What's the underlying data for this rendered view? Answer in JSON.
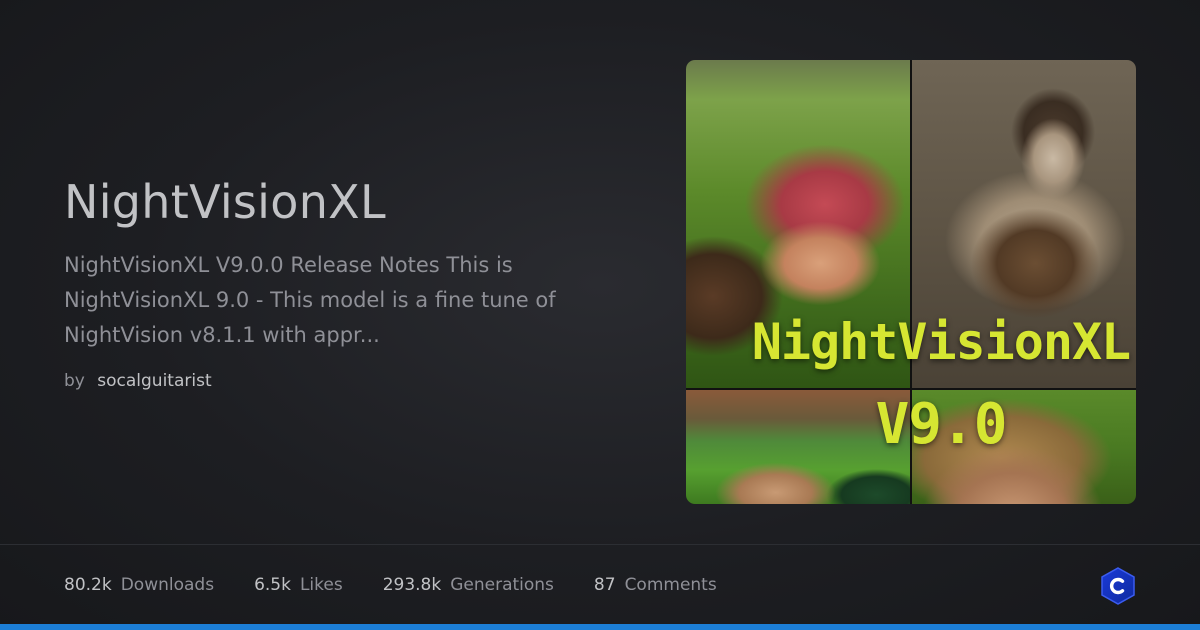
{
  "model": {
    "title": "NightVisionXL",
    "description": "NightVisionXL V9.0.0 Release Notes This is NightVisionXL 9.0 - This model is a fine tune of NightVision v8.1.1 with appr...",
    "by_label": "by",
    "author": "socalguitarist"
  },
  "preview": {
    "overlay_line1": "NightVisionXL",
    "overlay_line2": "V9.0",
    "overlay_color": "#d6e632"
  },
  "stats": [
    {
      "value": "80.2k",
      "label": "Downloads"
    },
    {
      "value": "6.5k",
      "label": "Likes"
    },
    {
      "value": "293.8k",
      "label": "Generations"
    },
    {
      "value": "87",
      "label": "Comments"
    }
  ],
  "brand": {
    "logo_icon": "civitai-logo-icon",
    "accent": "#1c7ed6"
  }
}
